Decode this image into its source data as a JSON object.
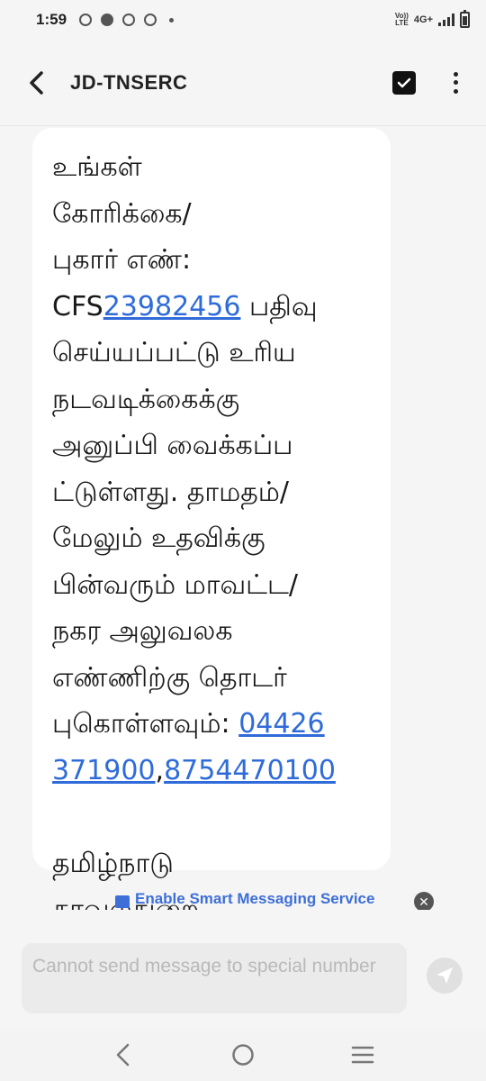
{
  "status_bar": {
    "time": "1:59",
    "volte_top": "Vo))",
    "volte_bottom": "LTE",
    "network": "4G+"
  },
  "header": {
    "title": "JD-TNSERC"
  },
  "message": {
    "lines": [
      "உங்கள்",
      "கோரிக்கை/",
      "புகார் எண்:",
      "CFS",
      "23982456",
      " பதிவு",
      "செய்யப்பட்டு உரிய",
      "நடவடிக்கைக்கு",
      "அனுப்பி வைக்கப்ப",
      "ட்டுள்ளது. தாமதம்/",
      "மேலும் உதவிக்கு",
      "பின்வரும் மாவட்ட/",
      "நகர அலுவலக",
      "எண்ணிற்கு தொடர்",
      "புகொள்ளவும்: ",
      "04426",
      "371900",
      ",",
      "8754470100",
      "தமிழ்நாடு",
      "காவல்துறை"
    ]
  },
  "banner": {
    "label": "Enable Smart Messaging Service"
  },
  "composer": {
    "placeholder": "Cannot send message to special number"
  },
  "colors": {
    "link": "#2f6bd9",
    "banner_accent": "#3e6fd8"
  }
}
